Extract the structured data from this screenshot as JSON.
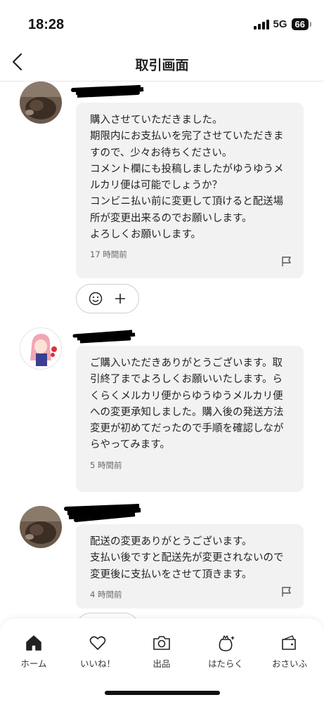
{
  "status": {
    "time": "18:28",
    "network": "5G",
    "battery": "66"
  },
  "header": {
    "title": "取引画面"
  },
  "messages": [
    {
      "text": "購入させていただきました。\n期限内にお支払いを完了させていただきますので、少々お待ちください。\nコメント欄にも投稿しましたがゆうゆうメルカリ便は可能でしょうか？\nコンビニ払い前に変更して頂けると配送場所が変更出来るのでお願いします。\nよろしくお願いします。",
      "time": "17 時間前"
    },
    {
      "text": "ご購入いただきありがとうございます。取引終了までよろしくお願いいたします。らくらくメルカリ便からゆうゆうメルカリ便への変更承知しました。購入後の発送方法変更が初めてだったので手順を確認しながらやってみます。",
      "time": "5 時間前"
    },
    {
      "text": "配送の変更ありがとうございます。\n支払い後ですと配送先が変更されないので変更後に支払いをさせて頂きます。",
      "time": "4 時間前"
    }
  ],
  "tabs": [
    {
      "label": "ホーム",
      "icon": "home-icon"
    },
    {
      "label": "いいね！",
      "icon": "heart-icon"
    },
    {
      "label": "出品",
      "icon": "camera-icon"
    },
    {
      "label": "はたらく",
      "icon": "sprout-bag-icon"
    },
    {
      "label": "おさいふ",
      "icon": "wallet-icon"
    }
  ]
}
